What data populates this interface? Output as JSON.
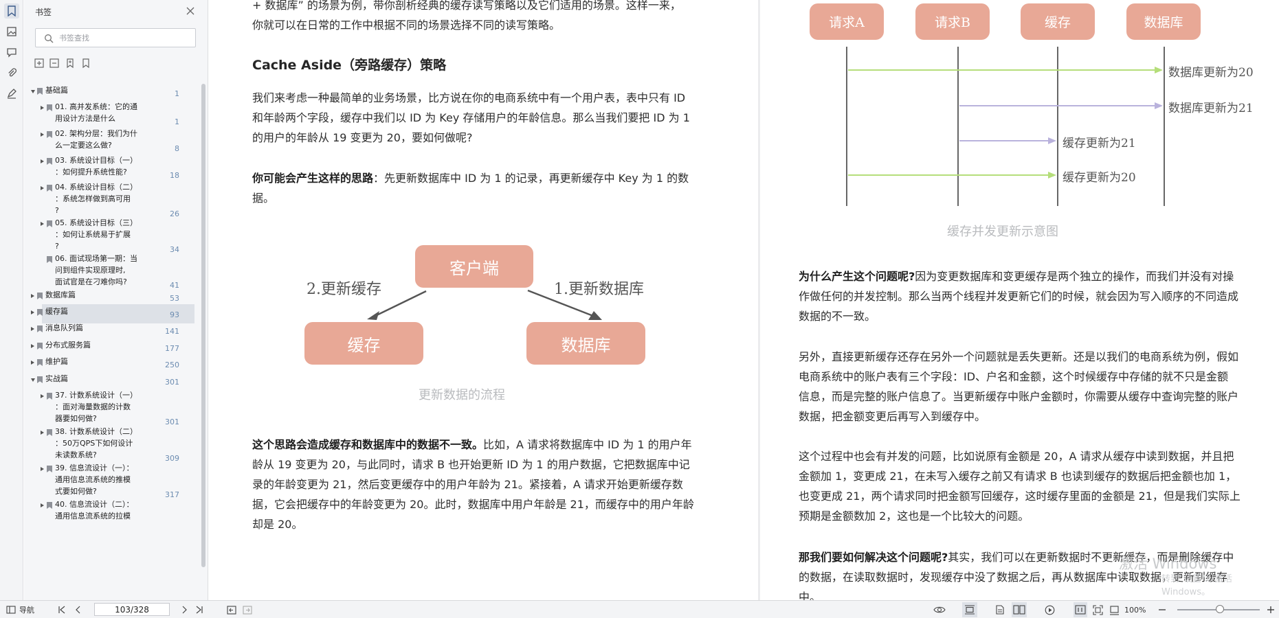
{
  "panel": {
    "title": "书签",
    "search_placeholder": "书签查找"
  },
  "bookmarks": [
    {
      "label": "基础篇",
      "page": "1",
      "expand": "down",
      "level": 0
    },
    {
      "label": "01. 高并发系统：它的通\n用设计方法是什么",
      "page": "1",
      "expand": "right",
      "level": 1
    },
    {
      "label": "02. 架构分层：我们为什\n么一定要这么做?",
      "page": "8",
      "expand": "right",
      "level": 1
    },
    {
      "label": "03. 系统设计目标（一）\n：如何提升系统性能?",
      "page": "18",
      "expand": "right",
      "level": 1
    },
    {
      "label": "04. 系统设计目标（二）\n：系统怎样做到高可用\n?",
      "page": "26",
      "expand": "right",
      "level": 1
    },
    {
      "label": "05. 系统设计目标（三）\n：如何让系统易于扩展\n?",
      "page": "34",
      "expand": "right",
      "level": 1
    },
    {
      "label": "06. 面试现场第一期：当\n问到组件实现原理时,\n面试官是在刁难你吗?",
      "page": "41",
      "expand": "none",
      "level": 1
    },
    {
      "label": "数据库篇",
      "page": "53",
      "expand": "right",
      "level": 0
    },
    {
      "label": "缓存篇",
      "page": "93",
      "expand": "right",
      "level": 0,
      "selected": true
    },
    {
      "label": "消息队列篇",
      "page": "141",
      "expand": "right",
      "level": 0
    },
    {
      "label": "分布式服务篇",
      "page": "177",
      "expand": "right",
      "level": 0
    },
    {
      "label": "维护篇",
      "page": "250",
      "expand": "right",
      "level": 0
    },
    {
      "label": "实战篇",
      "page": "301",
      "expand": "down",
      "level": 0
    },
    {
      "label": "37. 计数系统设计（一）\n：面对海量数据的计数\n器要如何做?",
      "page": "301",
      "expand": "right",
      "level": 1
    },
    {
      "label": "38. 计数系统设计（二）\n：50万QPS下如何设计\n未读数系统?",
      "page": "309",
      "expand": "right",
      "level": 1
    },
    {
      "label": "39. 信息流设计（一）：\n通用信息流系统的推模\n式要如何做?",
      "page": "317",
      "expand": "right",
      "level": 1
    },
    {
      "label": "40. 信息流设计（二）：\n通用信息流系统的拉模",
      "page": "",
      "expand": "right",
      "level": 1
    }
  ],
  "left_page": {
    "intro": "+ 数据库” 的场景为例，带你剖析经典的缓存读写策略以及它们适用的场景。这样一来，\n你就可以在日常的工作中根据不同的场景选择不同的读写策略。",
    "heading": "Cache Aside（旁路缓存）策略",
    "para1": "我们来考虑一种最简单的业务场景，比方说在你的电商系统中有一个用户表，表中只有 ID\n和年龄两个字段，缓存中我们以 ID 为 Key 存储用户的年龄信息。那么当我们要把 ID 为 1\n的用户的年龄从 19 变更为 20，要如何做呢?",
    "para2_bold": "你可能会产生这样的思路",
    "para2": "：先更新数据库中 ID 为 1 的记录，再更新缓存中 Key 为 1 的数\n据。",
    "diagram": {
      "client": "客户端",
      "cache": "缓存",
      "db": "数据库",
      "label_left": "2.更新缓存",
      "label_right": "1.更新数据库",
      "caption": "更新数据的流程"
    },
    "para3_bold": "这个思路会造成缓存和数据库中的数据不一致。",
    "para3": "比如，A 请求将数据库中 ID 为 1 的用户年\n龄从 19 变更为 20，与此同时，请求 B 也开始更新 ID 为 1 的用户数据，它把数据库中记\n录的年龄变更为 21，然后变更缓存中的用户年龄为 21。紧接着，A 请求开始更新缓存数\n据，它会把缓存中的年龄变更为 20。此时，数据库中用户年龄是 21，而缓存中的用户年龄\n却是 20。"
  },
  "right_page": {
    "seq": {
      "actors": [
        "请求A",
        "请求B",
        "缓存",
        "数据库"
      ],
      "msg1": "数据库更新为20",
      "msg2": "数据库更新为21",
      "msg3": "缓存更新为21",
      "msg4": "缓存更新为20",
      "caption": "缓存并发更新示意图",
      "color_green": "#b5de7a",
      "color_purple": "#b9b2dc"
    },
    "para1_bold": "为什么产生这个问题呢?",
    "para1": "因为变更数据库和变更缓存是两个独立的操作，而我们并没有对操\n作做任何的并发控制。那么当两个线程并发更新它们的时候，就会因为写入顺序的不同造成\n数据的不一致。",
    "para2": "另外，直接更新缓存还存在另外一个问题就是丢失更新。还是以我们的电商系统为例，假如\n电商系统中的账户表有三个字段：ID、户名和金额，这个时候缓存中存储的就不只是金额\n信息，而是完整的账户信息了。当更新缓存中账户金额时，你需要从缓存中查询完整的账户\n数据，把金额变更后再写入到缓存中。",
    "para3": "这个过程中也会有并发的问题，比如说原有金额是 20，A 请求从缓存中读到数据，并且把\n金额加 1，变更成 21，在未写入缓存之前又有请求 B 也读到缓存的数据后把金额也加 1，\n也变更成 21，两个请求同时把金额写回缓存，这时缓存里面的金额是 21，但是我们实际上\n预期是金额数加 2，这也是一个比较大的问题。",
    "para4_bold": "那我们要如何解决这个问题呢?",
    "para4": "其实，我们可以在更新数据时不更新缓存，而是删除缓存中\n的数据，在读取数据时，发现缓存中没了数据之后，再从数据库中读取数据，更新到缓存\n中。",
    "watermark": "激活 Windows",
    "watermark_sub": "转到\"设置\"以激活 Windows。"
  },
  "statusbar": {
    "nav_label": "导航",
    "page_value": "103/328",
    "zoom": "100%",
    "zoom_level": 0.52
  },
  "colors": {
    "box_fill": "#e8a896",
    "page_number": "#6b8bb0"
  }
}
